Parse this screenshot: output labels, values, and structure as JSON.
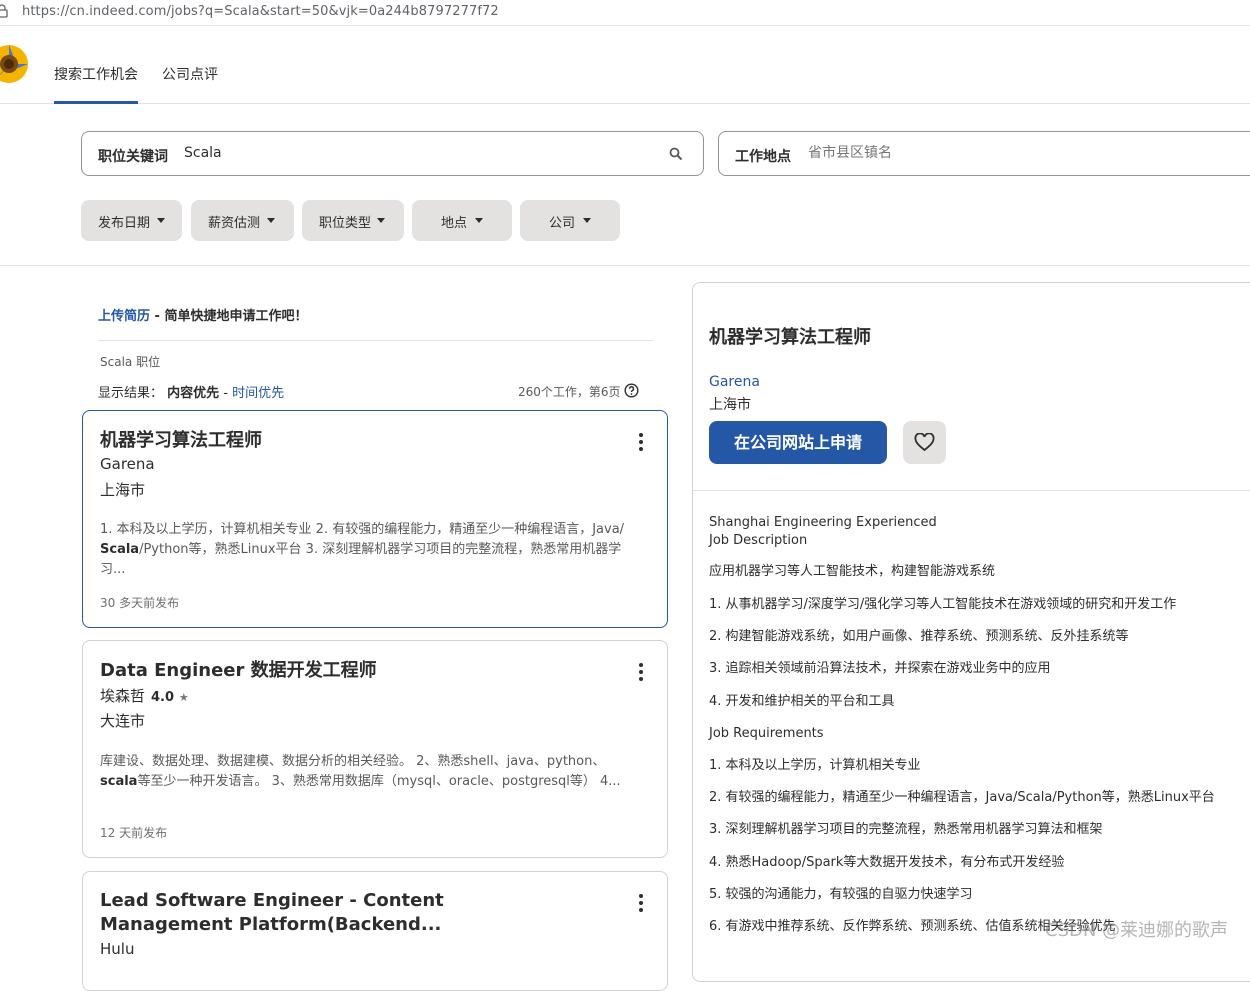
{
  "browser": {
    "url": "https://cn.indeed.com/jobs?q=Scala&start=50&vjk=0a244b8797277f72"
  },
  "nav": {
    "search_jobs": "搜索工作机会",
    "company_reviews": "公司点评"
  },
  "search": {
    "what_label": "职位关键词",
    "what_value": "Scala",
    "where_label": "工作地点",
    "where_placeholder": "省市县区镇名"
  },
  "filters": [
    "发布日期",
    "薪资估测",
    "职位类型",
    "地点",
    "公司"
  ],
  "results": {
    "upload_link": "上传简历",
    "upload_text": " - 简单快捷地申请工作吧！",
    "query_title": "Scala 职位",
    "sort_prefix": "显示结果：",
    "sort_relevance": "内容优先",
    "sort_sep": " - ",
    "sort_date": "时间优先",
    "count": "260个工作，第6页"
  },
  "jobs": [
    {
      "title": "机器学习算法工程师",
      "company": "Garena",
      "location": "上海市",
      "snippet_html_parts": [
        "1. 本科及以上学历，计算机相关专业 2. 有较强的编程能力，精通至少一种编程语言，Java/ ",
        "Scala",
        "/Python等，熟悉Linux平台 3. 深刻理解机器学习项目的完整流程，熟悉常用机器学习..."
      ],
      "date": "30 多天前发布"
    },
    {
      "title": "Data Engineer 数据开发工程师",
      "company": "埃森哲",
      "rating": "4.0",
      "location": "大连市",
      "snippet_html_parts": [
        "库建设、数据处理、数据建模、数据分析的相关经验。 2、熟悉shell、java、python、 ",
        "scala",
        "等至少一种开发语言。 3、熟悉常用数据库（mysql、oracle、postgresql等） 4..."
      ],
      "date": "12 天前发布"
    },
    {
      "title": "Lead Software Engineer - Content Management Platform(Backend...",
      "company": "Hulu"
    }
  ],
  "detail": {
    "title": "机器学习算法工程师",
    "company": "Garena",
    "location": "上海市",
    "apply_label": "在公司网站上申请",
    "lines": [
      "Shanghai Engineering Experienced",
      "Job Description",
      "应用机器学习等人工智能技术，构建智能游戏系统",
      "1. 从事机器学习/深度学习/强化学习等人工智能技术在游戏领域的研究和开发工作",
      "2. 构建智能游戏系统，如用户画像、推荐系统、预测系统、反外挂系统等",
      "3. 追踪相关领域前沿算法技术，并探索在游戏业务中的应用",
      "4. 开发和维护相关的平台和工具",
      "Job Requirements",
      "1. 本科及以上学历，计算机相关专业",
      "2. 有较强的编程能力，精通至少一种编程语言，Java/Scala/Python等，熟悉Linux平台",
      "3. 深刻理解机器学习项目的完整流程，熟悉常用机器学习算法和框架",
      "4. 熟悉Hadoop/Spark等大数据开发技术，有分布式开发经验",
      "5. 较强的沟通能力，有较强的自驱力快速学习",
      "6. 有游戏中推荐系统、反作弊系统、预测系统、估值系统相关经验优先"
    ]
  },
  "watermark": "CSDN @莱迪娜的歌声",
  "colors": {
    "accent": "#2557a7",
    "pill_bg": "#e4e2e0"
  }
}
